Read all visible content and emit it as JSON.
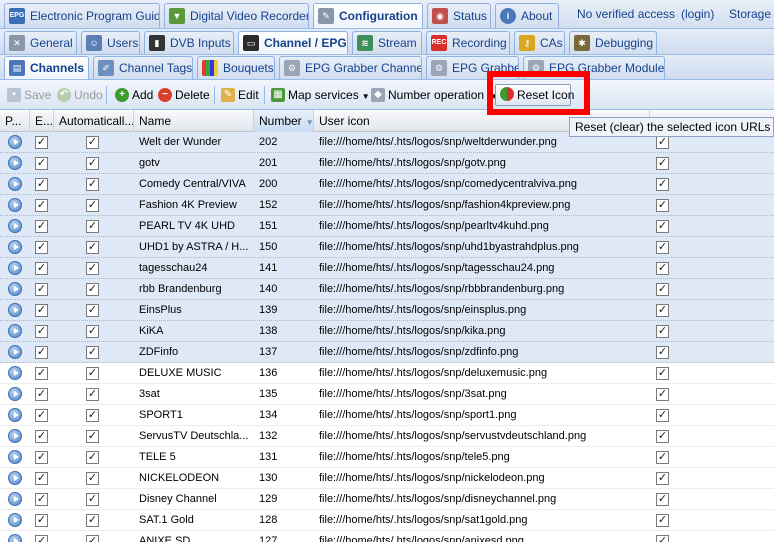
{
  "top_tabs": [
    {
      "label": "Electronic Program Guide",
      "icon": "epg-icon",
      "active": false
    },
    {
      "label": "Digital Video Recorder",
      "icon": "download-icon",
      "active": false
    },
    {
      "label": "Configuration",
      "icon": "wrench-icon",
      "active": true
    },
    {
      "label": "Status",
      "icon": "eye-icon",
      "active": false
    },
    {
      "label": "About",
      "icon": "info-icon",
      "active": false
    }
  ],
  "top_right": {
    "access": "No verified access",
    "login": "(login)",
    "storage": "Storage s"
  },
  "config_tabs": [
    {
      "label": "General",
      "icon": "tools-icon",
      "active": false
    },
    {
      "label": "Users",
      "icon": "users-icon",
      "active": false
    },
    {
      "label": "DVB Inputs",
      "icon": "dvb-icon",
      "active": false
    },
    {
      "label": "Channel / EPG",
      "icon": "tv-icon",
      "active": true
    },
    {
      "label": "Stream",
      "icon": "stream-icon",
      "active": false
    },
    {
      "label": "Recording",
      "icon": "rec-icon",
      "active": false
    },
    {
      "label": "CAs",
      "icon": "key-icon",
      "active": false
    },
    {
      "label": "Debugging",
      "icon": "bug-icon",
      "active": false
    }
  ],
  "channel_tabs": [
    {
      "label": "Channels",
      "icon": "channels-icon",
      "active": true
    },
    {
      "label": "Channel Tags",
      "icon": "tag-icon",
      "active": false
    },
    {
      "label": "Bouquets",
      "icon": "bouquet-icon",
      "active": false
    },
    {
      "label": "EPG Grabber Channels",
      "icon": "grabber-icon",
      "active": false
    },
    {
      "label": "EPG Grabber",
      "icon": "grabber-icon",
      "active": false
    },
    {
      "label": "EPG Grabber Modules",
      "icon": "grabber-icon",
      "active": false
    }
  ],
  "toolbar": {
    "save": "Save",
    "undo": "Undo",
    "add": "Add",
    "delete": "Delete",
    "edit": "Edit",
    "map_services": "Map services",
    "number_operations": "Number operation",
    "reset_icon": "Reset Icon"
  },
  "tooltip": "Reset (clear) the selected icon URLs",
  "columns": [
    "P...",
    "E...",
    "Automaticall...",
    "Name",
    "Number",
    "User icon"
  ],
  "colors": {
    "accent": "#15428b",
    "selected_row": "#dfe8f6",
    "highlight": "#ff0000"
  },
  "rows": [
    {
      "name": "Welt der Wunder",
      "number": "202",
      "icon": "file:///home/hts/.hts/logos/snp/weltderwunder.png",
      "selected": true
    },
    {
      "name": "gotv",
      "number": "201",
      "icon": "file:///home/hts/.hts/logos/snp/gotv.png",
      "selected": true
    },
    {
      "name": "Comedy Central/VIVA",
      "number": "200",
      "icon": "file:///home/hts/.hts/logos/snp/comedycentralviva.png",
      "selected": true
    },
    {
      "name": "Fashion 4K Preview",
      "number": "152",
      "icon": "file:///home/hts/.hts/logos/snp/fashion4kpreview.png",
      "selected": true
    },
    {
      "name": "PEARL TV 4K UHD",
      "number": "151",
      "icon": "file:///home/hts/.hts/logos/snp/pearltv4kuhd.png",
      "selected": true
    },
    {
      "name": "UHD1 by ASTRA / H...",
      "number": "150",
      "icon": "file:///home/hts/.hts/logos/snp/uhd1byastrahdplus.png",
      "selected": true
    },
    {
      "name": "tagesschau24",
      "number": "141",
      "icon": "file:///home/hts/.hts/logos/snp/tagesschau24.png",
      "selected": true
    },
    {
      "name": "rbb Brandenburg",
      "number": "140",
      "icon": "file:///home/hts/.hts/logos/snp/rbbbrandenburg.png",
      "selected": true
    },
    {
      "name": "EinsPlus",
      "number": "139",
      "icon": "file:///home/hts/.hts/logos/snp/einsplus.png",
      "selected": true
    },
    {
      "name": "KiKA",
      "number": "138",
      "icon": "file:///home/hts/.hts/logos/snp/kika.png",
      "selected": true
    },
    {
      "name": "ZDFinfo",
      "number": "137",
      "icon": "file:///home/hts/.hts/logos/snp/zdfinfo.png",
      "selected": true
    },
    {
      "name": "DELUXE MUSIC",
      "number": "136",
      "icon": "file:///home/hts/.hts/logos/snp/deluxemusic.png",
      "selected": false
    },
    {
      "name": "3sat",
      "number": "135",
      "icon": "file:///home/hts/.hts/logos/snp/3sat.png",
      "selected": false
    },
    {
      "name": "SPORT1",
      "number": "134",
      "icon": "file:///home/hts/.hts/logos/snp/sport1.png",
      "selected": false
    },
    {
      "name": "ServusTV Deutschla...",
      "number": "132",
      "icon": "file:///home/hts/.hts/logos/snp/servustvdeutschland.png",
      "selected": false
    },
    {
      "name": "TELE 5",
      "number": "131",
      "icon": "file:///home/hts/.hts/logos/snp/tele5.png",
      "selected": false
    },
    {
      "name": "NICKELODEON",
      "number": "130",
      "icon": "file:///home/hts/.hts/logos/snp/nickelodeon.png",
      "selected": false
    },
    {
      "name": "Disney Channel",
      "number": "129",
      "icon": "file:///home/hts/.hts/logos/snp/disneychannel.png",
      "selected": false
    },
    {
      "name": "SAT.1 Gold",
      "number": "128",
      "icon": "file:///home/hts/.hts/logos/snp/sat1gold.png",
      "selected": false
    },
    {
      "name": "ANIXE SD",
      "number": "127",
      "icon": "file:///home/hts/.hts/logos/snp/anixesd.png",
      "selected": false
    }
  ]
}
